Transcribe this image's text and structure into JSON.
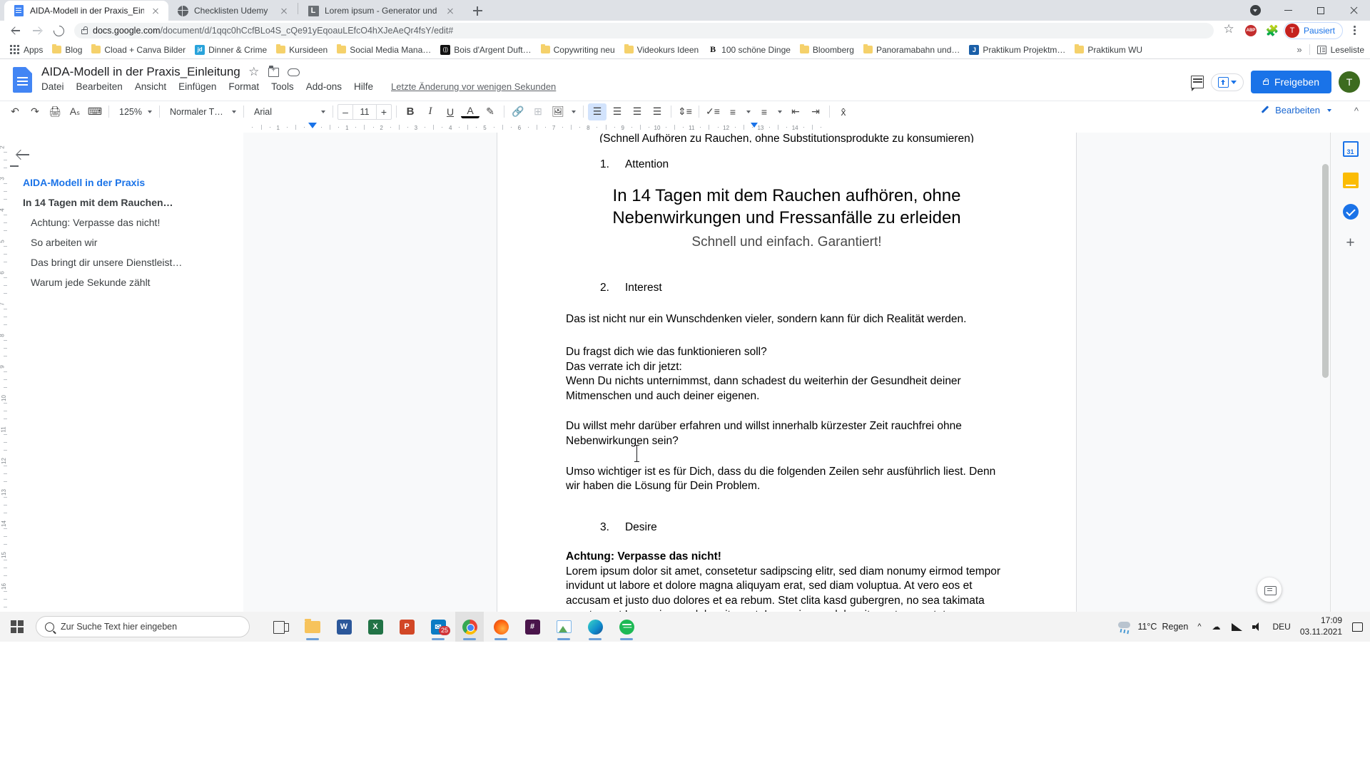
{
  "browser": {
    "tabs": [
      {
        "title": "AIDA-Modell in der Praxis_Einleit",
        "icon": "docs-icon",
        "active": true
      },
      {
        "title": "Checklisten Udemy",
        "icon": "globe-icon",
        "active": false
      },
      {
        "title": "Lorem ipsum - Generator und Inf",
        "icon": "lorem-icon",
        "active": false
      }
    ],
    "new_tab_label": "+",
    "window_controls": {
      "restore": "restore",
      "minimize": "–",
      "maximize": "□",
      "close": "✕"
    },
    "url_prefix": "docs.google.com",
    "url_suffix": "/document/d/1qqc0hCcfBLo4S_cQe91yEqoauLEfcO4hXJeAeQr4fsY/edit#",
    "profile_name": "Pausiert",
    "profile_initial": "T",
    "extension_labels": {
      "adblock": "ABP"
    },
    "bookmarks": [
      {
        "label": "Apps",
        "icon": "apps-grid-icon"
      },
      {
        "label": "Blog",
        "icon": "folder-icon"
      },
      {
        "label": "Cload + Canva Bilder",
        "icon": "folder-icon"
      },
      {
        "label": "Dinner & Crime",
        "icon": "jd-icon"
      },
      {
        "label": "Kursideen",
        "icon": "folder-icon"
      },
      {
        "label": "Social Media Mana…",
        "icon": "folder-icon"
      },
      {
        "label": "Bois d'Argent Duft…",
        "icon": "bois-icon"
      },
      {
        "label": "Copywriting neu",
        "icon": "folder-icon"
      },
      {
        "label": "Videokurs Ideen",
        "icon": "folder-icon"
      },
      {
        "label": "100 schöne Dinge",
        "icon": "b-icon"
      },
      {
        "label": "Bloomberg",
        "icon": "folder-icon"
      },
      {
        "label": "Panoramabahn und…",
        "icon": "folder-icon"
      },
      {
        "label": "Praktikum Projektm…",
        "icon": "j-icon"
      },
      {
        "label": "Praktikum WU",
        "icon": "folder-icon"
      }
    ],
    "bookmarks_overflow": "»",
    "reading_list": "Leseliste"
  },
  "docs": {
    "title": "AIDA-Modell in der Praxis_Einleitung",
    "menu": [
      "Datei",
      "Bearbeiten",
      "Ansicht",
      "Einfügen",
      "Format",
      "Tools",
      "Add-ons",
      "Hilfe"
    ],
    "last_edit": "Letzte Änderung vor wenigen Sekunden",
    "share_label": "Freigeben",
    "account_initial": "T",
    "toolbar": {
      "zoom": "125%",
      "style": "Normaler T…",
      "font": "Arial",
      "font_size": "11",
      "minus": "–",
      "plus": "+",
      "bold": "B",
      "italic": "I",
      "underline": "U",
      "text_color": "A",
      "edit_mode": "Bearbeiten"
    },
    "ruler": {
      "ticks": [
        "2",
        "1",
        "1",
        "2",
        "3",
        "4",
        "5",
        "6",
        "7",
        "8",
        "9",
        "10",
        "11",
        "12",
        "13",
        "14",
        "15",
        "16",
        "17",
        "18"
      ]
    },
    "outline": {
      "items": [
        {
          "label": "AIDA-Modell in der Praxis",
          "level": 0
        },
        {
          "label": "In 14 Tagen mit dem Rauchen…",
          "level": 1
        },
        {
          "label": "Achtung: Verpasse das nicht!",
          "level": 2
        },
        {
          "label": "So arbeiten wir",
          "level": 2
        },
        {
          "label": "Das bringt dir unsere Dienstleist…",
          "level": 2
        },
        {
          "label": "Warum jede Sekunde zählt",
          "level": 2
        }
      ]
    },
    "document": {
      "clipped_top_line": "(Schnell Aufhören zu Rauchen, ohne Substitutionsprodukte zu konsumieren)",
      "blocks": [
        {
          "type": "numbered",
          "num": "1.",
          "text": "Attention"
        },
        {
          "type": "h1",
          "text": "In 14 Tagen mit dem Rauchen aufhören, ohne Nebenwirkungen und Fressanfälle zu erleiden"
        },
        {
          "type": "h2",
          "text": "Schnell und einfach. Garantiert!"
        },
        {
          "type": "numbered",
          "num": "2.",
          "text": "Interest"
        },
        {
          "type": "p",
          "text": "Das ist nicht nur ein Wunschdenken vieler, sondern kann für dich Realität werden."
        },
        {
          "type": "p",
          "text": "Du fragst dich wie das funktionieren soll?"
        },
        {
          "type": "p-tight",
          "text": "Das verrate ich dir jetzt:"
        },
        {
          "type": "p-tight",
          "text": "Wenn Du nichts unternimmst, dann schadest du weiterhin der Gesundheit deiner Mitmenschen und auch deiner eigenen."
        },
        {
          "type": "p",
          "text": "Du willst mehr darüber erfahren und willst innerhalb kürzester Zeit rauchfrei ohne Nebenwirkungen sein?"
        },
        {
          "type": "p",
          "text": "Umso wichtiger ist es für Dich, dass du die folgenden Zeilen sehr ausführlich liest. Denn wir haben die Lösung für Dein Problem."
        },
        {
          "type": "numbered",
          "num": "3.",
          "text": "Desire"
        },
        {
          "type": "p-bold",
          "text": "Achtung: Verpasse das nicht!"
        },
        {
          "type": "p-tight",
          "text": "Lorem ipsum dolor sit amet, consetetur sadipscing elitr, sed diam nonumy eirmod tempor invidunt ut labore et dolore magna aliquyam erat, sed diam voluptua. At vero eos et accusam et justo duo dolores et ea rebum. Stet clita kasd gubergren, no sea takimata sanctus est Lorem ipsum dolor sit amet. Lorem ipsum dolor sit amet, consetetur sadipscing"
        }
      ]
    },
    "side_rail": {
      "items": [
        {
          "name": "calendar-icon",
          "label": "31"
        },
        {
          "name": "keep-icon",
          "label": ""
        },
        {
          "name": "tasks-icon",
          "label": ""
        },
        {
          "name": "add-ons-plus-icon",
          "label": "+"
        }
      ]
    }
  },
  "taskbar": {
    "search_placeholder": "Zur Suche Text hier eingeben",
    "apps": [
      {
        "name": "task-view-icon",
        "label": ""
      },
      {
        "name": "file-explorer-icon",
        "label": ""
      },
      {
        "name": "word-icon",
        "label": "W"
      },
      {
        "name": "excel-icon",
        "label": "X"
      },
      {
        "name": "powerpoint-icon",
        "label": "P"
      },
      {
        "name": "mail-icon",
        "label": "25"
      },
      {
        "name": "chrome-icon",
        "label": ""
      },
      {
        "name": "firefox-icon",
        "label": ""
      },
      {
        "name": "slack-icon",
        "label": ""
      },
      {
        "name": "photos-icon",
        "label": ""
      },
      {
        "name": "edge-icon",
        "label": ""
      },
      {
        "name": "spotify-icon",
        "label": ""
      }
    ],
    "weather_temp": "11°C",
    "weather_text": "Regen",
    "language": "DEU",
    "time": "17:09",
    "date": "03.11.2021"
  },
  "colors": {
    "accent": "#1a73e8",
    "chrome_tabstrip": "#dee1e6",
    "docs_blue": "#4285f4",
    "taskbar": "#f3f3f3"
  }
}
